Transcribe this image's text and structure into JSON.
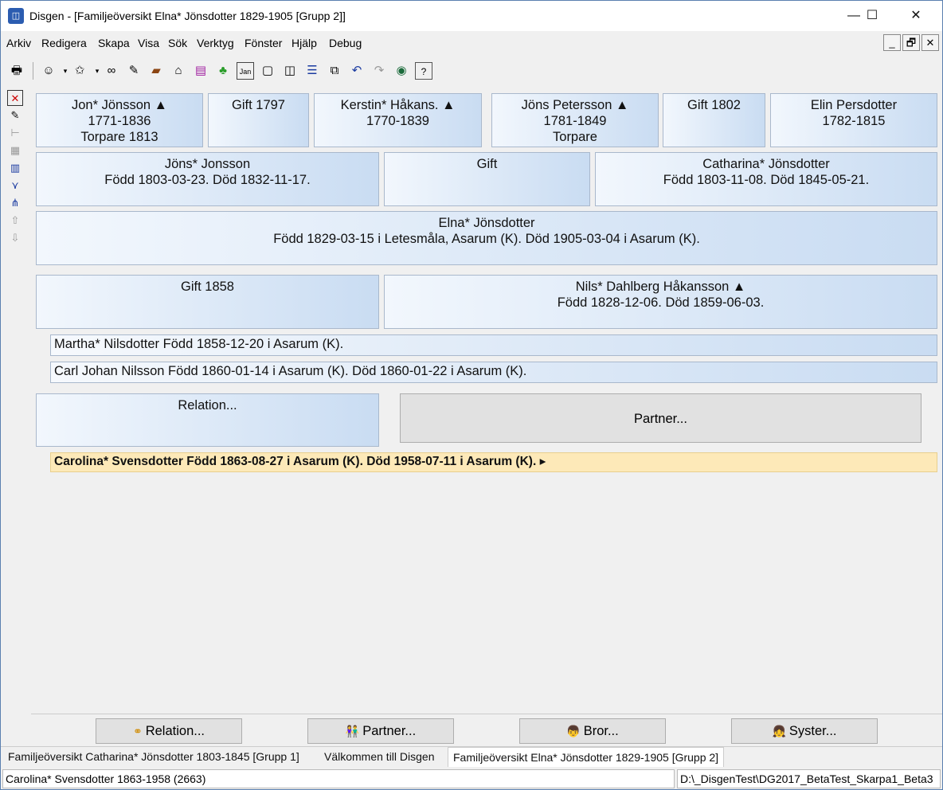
{
  "window": {
    "app_icon": "disgen-app-icon",
    "title": "Disgen - [Familjeöversikt Elna* Jönsdotter 1829-1905 [Grupp 2]]",
    "minimize": "—",
    "maximize": "☐",
    "close": "✕"
  },
  "menu": [
    "Arkiv",
    "Redigera",
    "Skapa",
    "Visa",
    "Sök",
    "Verktyg",
    "Fönster",
    "Hjälp",
    "Debug"
  ],
  "mdi": {
    "minimize": "_",
    "restore": "🗗",
    "close": "✕"
  },
  "toolbar_icons": [
    "print-icon",
    "person-icon",
    "star-person-icon",
    "binoculars-icon",
    "edit-icon",
    "book-icon",
    "home-icon",
    "books-icon",
    "map-icon",
    "calendar-icon",
    "window-single-icon",
    "window-split-icon",
    "window-rows-icon",
    "window-cascade-icon",
    "undo-icon",
    "redo-icon",
    "globe-icon",
    "help-icon"
  ],
  "grandparents": [
    {
      "line1": "Jon* Jönsson ▲",
      "line2": "1771-1836",
      "line3": "Torpare  1813"
    },
    {
      "line1": "Gift 1797",
      "line2": "",
      "line3": ""
    },
    {
      "line1": "Kerstin* Håkans. ▲",
      "line2": "1770-1839",
      "line3": ""
    },
    {
      "line1": "Jöns Petersson ▲",
      "line2": "1781-1849",
      "line3": "Torpare"
    },
    {
      "line1": "Gift 1802",
      "line2": "",
      "line3": ""
    },
    {
      "line1": "Elin Persdotter",
      "line2": "1782-1815",
      "line3": ""
    }
  ],
  "parents": [
    {
      "line1": "Jöns* Jonsson",
      "line2": "Född 1803-03-23. Död 1832-11-17."
    },
    {
      "line1": "Gift",
      "line2": ""
    },
    {
      "line1": "Catharina* Jönsdotter",
      "line2": "Född 1803-11-08. Död 1845-05-21."
    }
  ],
  "main_person": {
    "line1": "Elna* Jönsdotter",
    "line2": "Född 1829-03-15 i Letesmåla, Asarum (K). Död 1905-03-04 i Asarum (K)."
  },
  "marriage1": {
    "label": "Gift 1858"
  },
  "spouse1": {
    "line1": "Nils* Dahlberg Håkansson ▲",
    "line2": "Född 1828-12-06. Död 1859-06-03."
  },
  "children": [
    "Martha* Nilsdotter Född 1858-12-20 i Asarum (K).",
    "Carl Johan Nilsson Född 1860-01-14 i Asarum (K). Död 1860-01-22 i Asarum (K)."
  ],
  "relation_card": {
    "label": "Relation..."
  },
  "partner_button": {
    "label": "Partner..."
  },
  "selected_child": "Carolina* Svensdotter Född 1863-08-27 i Asarum (K). Död 1958-07-11 i Asarum (K). ▸",
  "bottom_buttons": [
    {
      "icon": "relation-icon",
      "glyph": "⚭",
      "label": "Relation..."
    },
    {
      "icon": "partner-icon",
      "glyph": "👫",
      "label": "Partner..."
    },
    {
      "icon": "brother-icon",
      "glyph": "👦",
      "label": "Bror..."
    },
    {
      "icon": "sister-icon",
      "glyph": "👧",
      "label": "Syster..."
    }
  ],
  "tabs": [
    "Familjeöversikt Catharina* Jönsdotter 1803-1845 [Grupp 1]",
    "Välkommen till Disgen",
    "Familjeöversikt Elna* Jönsdotter 1829-1905 [Grupp 2]"
  ],
  "status": {
    "left": "Carolina* Svensdotter 1863-1958 (2663)",
    "right": "D:\\_DisgenTest\\DG2017_BetaTest_Skarpa1_Beta3"
  }
}
